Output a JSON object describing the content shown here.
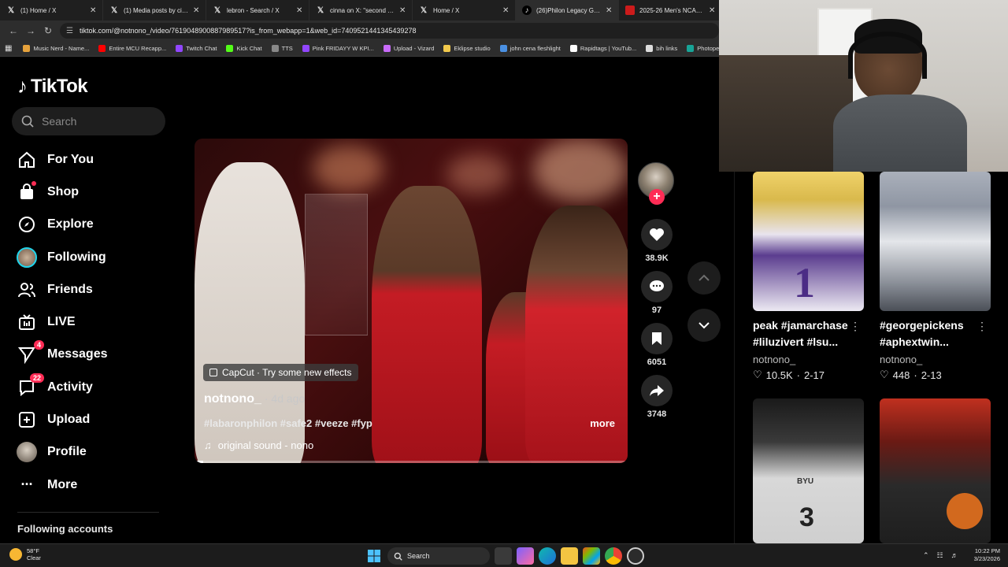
{
  "browser": {
    "tabs": [
      {
        "title": "(1) Home / X",
        "icon": "x-logo",
        "active": false
      },
      {
        "title": "(1) Media posts by cinna",
        "icon": "x-logo",
        "active": false
      },
      {
        "title": "lebron - Search / X",
        "icon": "x-logo",
        "active": false
      },
      {
        "title": "cinna on X: \"second set i",
        "icon": "x-logo",
        "active": false
      },
      {
        "title": "Home / X",
        "icon": "x-logo",
        "active": false
      },
      {
        "title": "(26)Philon Legacy Game H",
        "icon": "tiktok-logo",
        "active": true
      },
      {
        "title": "2025-26 Men's NCAA Tou",
        "icon": "ncaa-logo",
        "active": false
      }
    ],
    "url": "tiktok.com/@notnono_/video/7619048900887989517?is_from_webapp=1&web_id=7409521441345439278",
    "bookmarks": [
      {
        "label": "Music Nerd - Name...",
        "color": "#e6a23c"
      },
      {
        "label": "Entire MCU Recapp...",
        "color": "#ff0000"
      },
      {
        "label": "Twitch Chat",
        "color": "#9146ff"
      },
      {
        "label": "Kick Chat",
        "color": "#53fc18"
      },
      {
        "label": "TTS",
        "color": "#888888"
      },
      {
        "label": "Pink FRIDAYY W KPI...",
        "color": "#9146ff"
      },
      {
        "label": "Upload - Vizard",
        "color": "#c86bfa"
      },
      {
        "label": "Eklipse studio",
        "color": "#f2c94c"
      },
      {
        "label": "john cena fleshlight",
        "color": "#4a90e2"
      },
      {
        "label": "Rapidtags | YouTub...",
        "color": "#ffffff"
      },
      {
        "label": "bih links",
        "color": "#dddddd"
      },
      {
        "label": "Photopea",
        "color": "#18a497"
      }
    ]
  },
  "tiktok": {
    "logo_text": "TikTok",
    "search_placeholder": "Search",
    "nav": [
      {
        "label": "For You",
        "icon": "home-icon",
        "badge": ""
      },
      {
        "label": "Shop",
        "icon": "shop-icon",
        "badge": ""
      },
      {
        "label": "Explore",
        "icon": "compass-icon",
        "badge": ""
      },
      {
        "label": "Following",
        "icon": "following-avatar-icon",
        "badge": ""
      },
      {
        "label": "Friends",
        "icon": "friends-icon",
        "badge": ""
      },
      {
        "label": "LIVE",
        "icon": "live-icon",
        "badge": ""
      },
      {
        "label": "Messages",
        "icon": "messages-icon",
        "badge": "4"
      },
      {
        "label": "Activity",
        "icon": "activity-icon",
        "badge": "22"
      },
      {
        "label": "Upload",
        "icon": "upload-icon",
        "badge": ""
      },
      {
        "label": "Profile",
        "icon": "profile-avatar-icon",
        "badge": ""
      },
      {
        "label": "More",
        "icon": "more-icon",
        "badge": ""
      }
    ],
    "following_accounts_label": "Following accounts",
    "video": {
      "capcut_label": "CapCut · Try some new effects",
      "username": "notnono_",
      "age": "· 4d ago",
      "hashtags": "#labaronphilon #safe2 #veeze #fyp",
      "more_label": "more",
      "sound": "original sound - nono",
      "progress": 0.02
    },
    "actions": {
      "likes": "38.9K",
      "comments": "97",
      "saves": "6051",
      "shares": "3748"
    },
    "grid": [
      {
        "caption": "peak #jamarchase #liluzivert #lsu...",
        "author": "notnono_",
        "likes": "10.5K",
        "date": "2-17"
      },
      {
        "caption": "#georgepickens #aphextwin...",
        "author": "notnono_",
        "likes": "448",
        "date": "2-13"
      },
      {
        "caption": "",
        "author": "",
        "likes": "",
        "date": ""
      },
      {
        "caption": "",
        "author": "",
        "likes": "",
        "date": ""
      }
    ],
    "thumb_jersey_numbers": [
      "1",
      "3"
    ],
    "thumb_jersey_text": "BYU"
  },
  "taskbar": {
    "temperature": "58°F",
    "condition": "Clear",
    "search_label": "Search",
    "time": "10:22 PM",
    "date": "3/23/2026"
  }
}
